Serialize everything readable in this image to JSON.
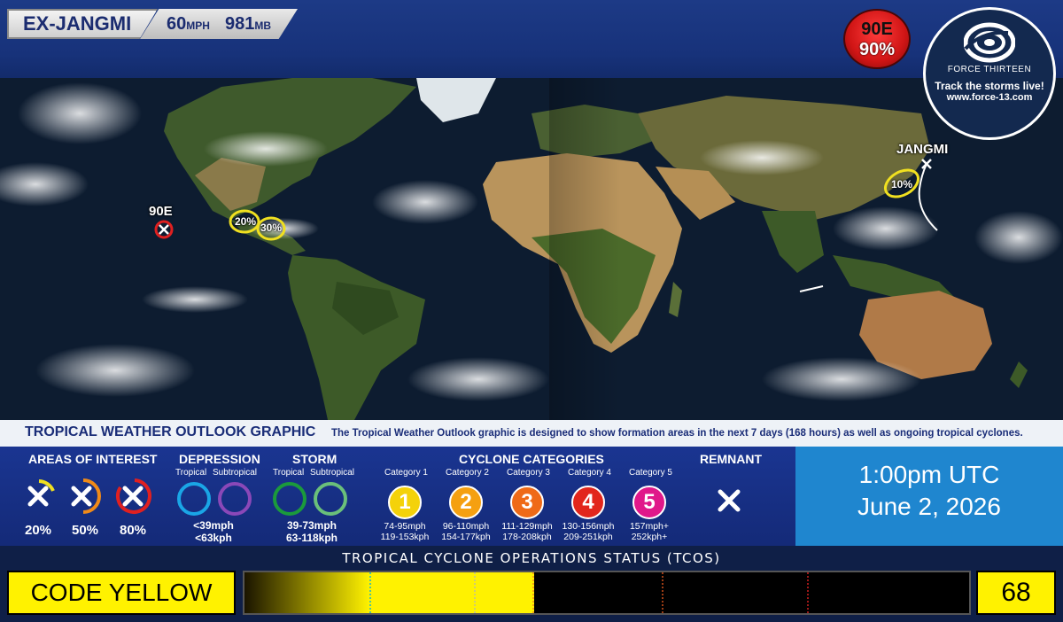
{
  "header": {
    "storm_name": "EX-JANGMI",
    "wind_value": "60",
    "wind_unit": "MPH",
    "pressure_value": "981",
    "pressure_unit": "MB",
    "invest_name": "90E",
    "invest_pct": "90%",
    "logo_name": "FORCE THIRTEEN",
    "logo_tagline": "Track the storms live!",
    "logo_url": "www.force-13.com"
  },
  "map": {
    "labels": {
      "invest_90e": "90E",
      "jangmi": "JANGMI"
    },
    "areas": [
      {
        "pct": "20%"
      },
      {
        "pct": "30%"
      },
      {
        "pct": "10%"
      }
    ],
    "colors": {
      "ocean": "#0c1a2e",
      "land": "#3f5a2c",
      "desert": "#b9945c",
      "outlook_20": "#f0e020",
      "invest_ring": "#e02020"
    }
  },
  "outlook": {
    "title": "TROPICAL WEATHER OUTLOOK GRAPHIC",
    "description": "The Tropical Weather Outlook graphic is designed to show formation areas in the next 7 days (168 hours) as well as ongoing tropical cyclones."
  },
  "legend": {
    "areas_title": "AREAS OF INTEREST",
    "areas": [
      "20%",
      "50%",
      "80%"
    ],
    "depression_title": "DEPRESSION",
    "depression_sub": [
      "Tropical",
      "Subtropical"
    ],
    "depression_range": [
      "<39mph",
      "<63kph"
    ],
    "storm_title": "STORM",
    "storm_sub": [
      "Tropical",
      "Subtropical"
    ],
    "storm_range": [
      "39-73mph",
      "63-118kph"
    ],
    "cyclone_title": "CYCLONE CATEGORIES",
    "categories": [
      {
        "label": "Category 1",
        "num": "1",
        "mph": "74-95mph",
        "kph": "119-153kph",
        "color": "#f4d20a"
      },
      {
        "label": "Category 2",
        "num": "2",
        "mph": "96-110mph",
        "kph": "154-177kph",
        "color": "#f5a011"
      },
      {
        "label": "Category 3",
        "num": "3",
        "mph": "111-129mph",
        "kph": "178-208kph",
        "color": "#ef6a17"
      },
      {
        "label": "Category 4",
        "num": "4",
        "mph": "130-156mph",
        "kph": "209-251kph",
        "color": "#e2261c"
      },
      {
        "label": "Category 5",
        "num": "5",
        "mph": "157mph+",
        "kph": "252kph+",
        "color": "#e0188a"
      }
    ],
    "remnant_title": "REMNANT"
  },
  "time": {
    "line1": "1:00pm UTC",
    "line2": "June 2, 2026"
  },
  "tcos": {
    "title": "TROPICAL CYCLONE OPERATIONS STATUS (TCOS)",
    "code_label": "CODE YELLOW",
    "value": "68",
    "level_fraction": 0.4,
    "color": "#fff200"
  }
}
